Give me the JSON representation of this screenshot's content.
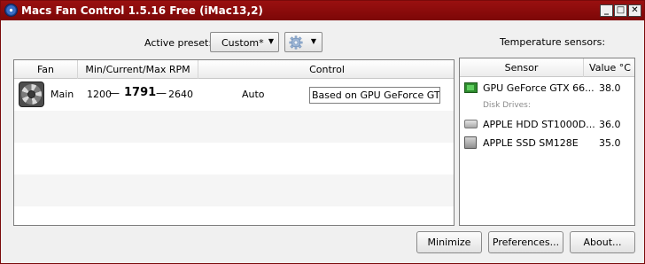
{
  "window": {
    "title": "Macs Fan Control 1.5.16 Free (iMac13,2)",
    "minimize_glyph": "_",
    "maximize_glyph": "□",
    "close_glyph": "✕"
  },
  "preset": {
    "label": "Active preset:",
    "selected": "Custom*",
    "dropdown_glyph": "▼"
  },
  "fans": {
    "columns": [
      "Fan",
      "Min/Current/Max RPM",
      "Control"
    ],
    "rows": [
      {
        "name": "Main",
        "min": "1200",
        "dash": "—",
        "current": "1791",
        "max": "2640",
        "mode": "Auto",
        "control": "Based on GPU GeForce GTX..."
      }
    ]
  },
  "sensors": {
    "title": "Temperature sensors:",
    "columns": [
      "Sensor",
      "Value °C"
    ],
    "items": [
      {
        "name": "GPU GeForce GTX 66...",
        "value": "38.0",
        "icon": "gpu-icon"
      },
      {
        "group": "Disk Drives:"
      },
      {
        "name": "APPLE HDD ST1000D...",
        "value": "36.0",
        "icon": "hdd-icon"
      },
      {
        "name": "APPLE SSD SM128E",
        "value": "35.0",
        "icon": "ssd-icon"
      }
    ]
  },
  "buttons": {
    "minimize": "Minimize",
    "preferences": "Preferences...",
    "about": "About..."
  },
  "colors": {
    "titlebar": "#8a0b0b",
    "window_bg": "#f0f0f0",
    "row_alt": "#f5f5f5"
  }
}
